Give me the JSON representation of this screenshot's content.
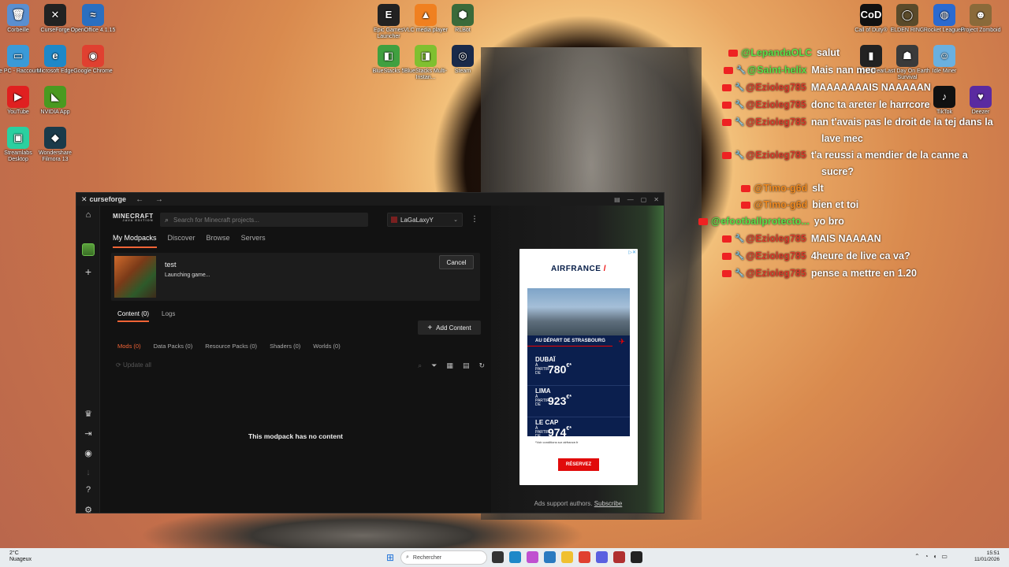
{
  "desktop": {
    "icons": [
      {
        "label": "Corbeille",
        "glyph": "🗑",
        "color": "#5a8fd0"
      },
      {
        "label": "CurseForge",
        "glyph": "✕",
        "color": "#222222"
      },
      {
        "label": "OpenOffice 4.1.15",
        "glyph": "≈",
        "color": "#2a6fc0"
      },
      {
        "label": "Ce PC - Raccourci",
        "glyph": "▭",
        "color": "#3a9ad8"
      },
      {
        "label": "Microsoft Edge",
        "glyph": "e",
        "color": "#1e88c8"
      },
      {
        "label": "Google Chrome",
        "glyph": "◉",
        "color": "#e04030"
      },
      {
        "label": "YouTube",
        "glyph": "▶",
        "color": "#e02020"
      },
      {
        "label": "NVIDIA App",
        "glyph": "◣",
        "color": "#4a9a20"
      },
      {
        "label": "Streamlabs Desktop",
        "glyph": "▣",
        "color": "#2ad0a0"
      },
      {
        "label": "Wondershare Filmora 13",
        "glyph": "◆",
        "color": "#1a3a4a"
      },
      {
        "label": "Epic Games Launcher",
        "glyph": "E",
        "color": "#222222"
      },
      {
        "label": "VLC media player",
        "glyph": "▲",
        "color": "#f08020"
      },
      {
        "label": "RLBot",
        "glyph": "⬢",
        "color": "#3a6a3a"
      },
      {
        "label": "BlueStacks 5",
        "glyph": "◧",
        "color": "#40a040"
      },
      {
        "label": "BlueStacks Multi-Instan...",
        "glyph": "◨",
        "color": "#80c030"
      },
      {
        "label": "Steam",
        "glyph": "◎",
        "color": "#1a2a4a"
      },
      {
        "label": "Call of Duty®",
        "glyph": "CoD",
        "color": "#111111"
      },
      {
        "label": "ELDEN RING",
        "glyph": "◯",
        "color": "#5a4a2a"
      },
      {
        "label": "Rocket League®",
        "glyph": "◍",
        "color": "#2a6ad0"
      },
      {
        "label": "Project Zomboid",
        "glyph": "☻",
        "color": "#8a6a3a"
      },
      {
        "label": "Cry of Fear",
        "glyph": "▮",
        "color": "#222222"
      },
      {
        "label": "Last Day On Earth Survival",
        "glyph": "☗",
        "color": "#3a3a3a"
      },
      {
        "label": "Idle Miner",
        "glyph": "☺",
        "color": "#6ab0e0"
      },
      {
        "label": "TikTok",
        "glyph": "♪",
        "color": "#111111"
      },
      {
        "label": "Deezer",
        "glyph": "♥",
        "color": "#5a2aa0"
      }
    ]
  },
  "window": {
    "title": "curseforge",
    "nav_glyphs": "← →",
    "controls": [
      "▤",
      "—",
      "▢",
      "✕"
    ]
  },
  "rail": {
    "home_icon": "⌂",
    "add_icon": "+",
    "bottom_icons": [
      "♛",
      "⇥",
      "◉",
      "↓",
      "?",
      "⚙"
    ]
  },
  "header": {
    "game_logo": "MINECRAFT",
    "game_edition": "JAVA EDITION",
    "search_placeholder": "Search for Minecraft projects...",
    "profile_name": "LaGaLaxyY",
    "chevron": "⌄",
    "kebab": "⋮"
  },
  "tabs": [
    {
      "label": "My Modpacks",
      "active": true
    },
    {
      "label": "Discover"
    },
    {
      "label": "Browse"
    },
    {
      "label": "Servers"
    }
  ],
  "modpack": {
    "name": "test",
    "status": "Launching game...",
    "cancel_label": "Cancel"
  },
  "subtabs": [
    {
      "label": "Content (0)",
      "active": true
    },
    {
      "label": "Logs"
    }
  ],
  "add_content_label": "Add Content",
  "filters": [
    {
      "label": "Mods (0)",
      "active": true
    },
    {
      "label": "Data Packs (0)"
    },
    {
      "label": "Resource Packs (0)"
    },
    {
      "label": "Shaders (0)"
    },
    {
      "label": "Worlds (0)"
    }
  ],
  "update_all_label": "Update all",
  "empty_message": "This modpack has no content",
  "ad": {
    "brand": "AIRFRANCE",
    "brand_mark": "/",
    "departure": "AU DÉPART DE STRASBOURG",
    "price_prefix": "À PARTIR DE",
    "destinations": [
      {
        "city": "DUBAÏ",
        "price": "780",
        "currency": "€*"
      },
      {
        "city": "LIMA",
        "price": "923",
        "currency": "€*"
      },
      {
        "city": "LE CAP",
        "price": "974",
        "currency": "€*"
      }
    ],
    "conditions": "*Voir conditions sur airfrance.fr",
    "cta": "RÉSERVEZ",
    "support_text": "Ads support authors.",
    "subscribe": "Subscribe"
  },
  "chat": [
    {
      "user": "@LepandaOLC",
      "text": "salut",
      "color": "green",
      "wrench": false
    },
    {
      "user": "@Saint-helix",
      "text": "Mais nan mec",
      "color": "green",
      "wrench": true
    },
    {
      "user": "@Ezioleg785",
      "text": "MAAAAAAAIS NAAAAAN",
      "color": "red",
      "wrench": true
    },
    {
      "user": "@Ezioleg785",
      "text": "donc ta areter le harrcore",
      "color": "red",
      "wrench": true
    },
    {
      "user": "@Ezioleg785",
      "text": "nan t'avais pas le droit de la tej dans la",
      "color": "red",
      "wrench": true
    },
    {
      "user": "",
      "text": "lave mec",
      "color": "red",
      "wrench": false
    },
    {
      "user": "@Ezioleg785",
      "text": "t'a reussi a mendier de la canne a",
      "color": "red",
      "wrench": true
    },
    {
      "user": "",
      "text": "sucre?",
      "color": "red",
      "wrench": false
    },
    {
      "user": "@Timo-g6d",
      "text": "slt",
      "color": "orange",
      "wrench": false
    },
    {
      "user": "@Timo-g6d",
      "text": "bien et toi",
      "color": "orange",
      "wrench": false
    },
    {
      "user": "@efootballprotecto...",
      "text": "yo bro",
      "color": "green",
      "wrench": false
    },
    {
      "user": "@Ezioleg785",
      "text": "MAIS NAAAAN",
      "color": "red",
      "wrench": true
    },
    {
      "user": "@Ezioleg785",
      "text": "4heure de live ca va?",
      "color": "red",
      "wrench": true
    },
    {
      "user": "@Ezioleg785",
      "text": "pense a mettre en 1.20",
      "color": "red",
      "wrench": true
    }
  ],
  "taskbar": {
    "temp": "2°C",
    "weather": "Nuageux",
    "search_label": "Rechercher",
    "time": "15:51",
    "date": "11/01/2026"
  }
}
